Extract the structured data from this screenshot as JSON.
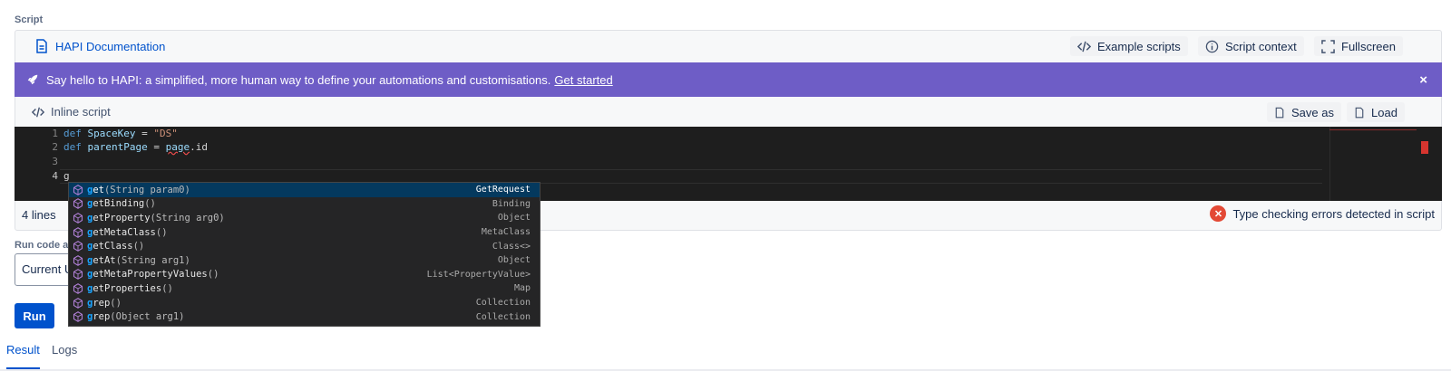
{
  "script_section": {
    "label": "Script"
  },
  "topbar": {
    "doc_link": "HAPI Documentation",
    "example_scripts": "Example scripts",
    "script_context": "Script context",
    "fullscreen": "Fullscreen"
  },
  "banner": {
    "text": "Say hello to HAPI: a simplified, more human way to define your automations and customisations.",
    "link": "Get started",
    "close": "×",
    "color": "#6e5dc6"
  },
  "scriptbar": {
    "inline_script": "Inline script",
    "save_as": "Save as",
    "load": "Load"
  },
  "editor": {
    "line_numbers": [
      "1",
      "2",
      "3",
      "4"
    ],
    "line1": {
      "kw": "def",
      "name": "SpaceKey",
      "op": " = ",
      "str": "\"DS\""
    },
    "line2": {
      "kw": "def",
      "name": "parentPage",
      "op": " = ",
      "obj": "page",
      "rest": ".id"
    },
    "line4": "g"
  },
  "status": {
    "lines": "4 lines",
    "error": "Type checking errors detected in script"
  },
  "suggestions": [
    {
      "match": "g",
      "name": "et",
      "params": "(String param0)",
      "type": "GetRequest"
    },
    {
      "match": "g",
      "name": "etBinding",
      "params": "()",
      "type": "Binding"
    },
    {
      "match": "g",
      "name": "etProperty",
      "params": "(String arg0)",
      "type": "Object"
    },
    {
      "match": "g",
      "name": "etMetaClass",
      "params": "()",
      "type": "MetaClass"
    },
    {
      "match": "g",
      "name": "etClass",
      "params": "()",
      "type": "Class<>"
    },
    {
      "match": "g",
      "name": "etAt",
      "params": "(String arg1)",
      "type": "Object"
    },
    {
      "match": "g",
      "name": "etMetaPropertyValues",
      "params": "()",
      "type": "List<PropertyValue>"
    },
    {
      "match": "g",
      "name": "etProperties",
      "params": "()",
      "type": "Map"
    },
    {
      "match": "g",
      "name": "rep",
      "params": "()",
      "type": "Collection"
    },
    {
      "match": "g",
      "name": "rep",
      "params": "(Object arg1)",
      "type": "Collection"
    }
  ],
  "run": {
    "label": "Run code as",
    "select_value": "Current U",
    "button": "Run"
  },
  "tabs": [
    {
      "label": "Result",
      "active": true
    },
    {
      "label": "Logs",
      "active": false
    }
  ]
}
